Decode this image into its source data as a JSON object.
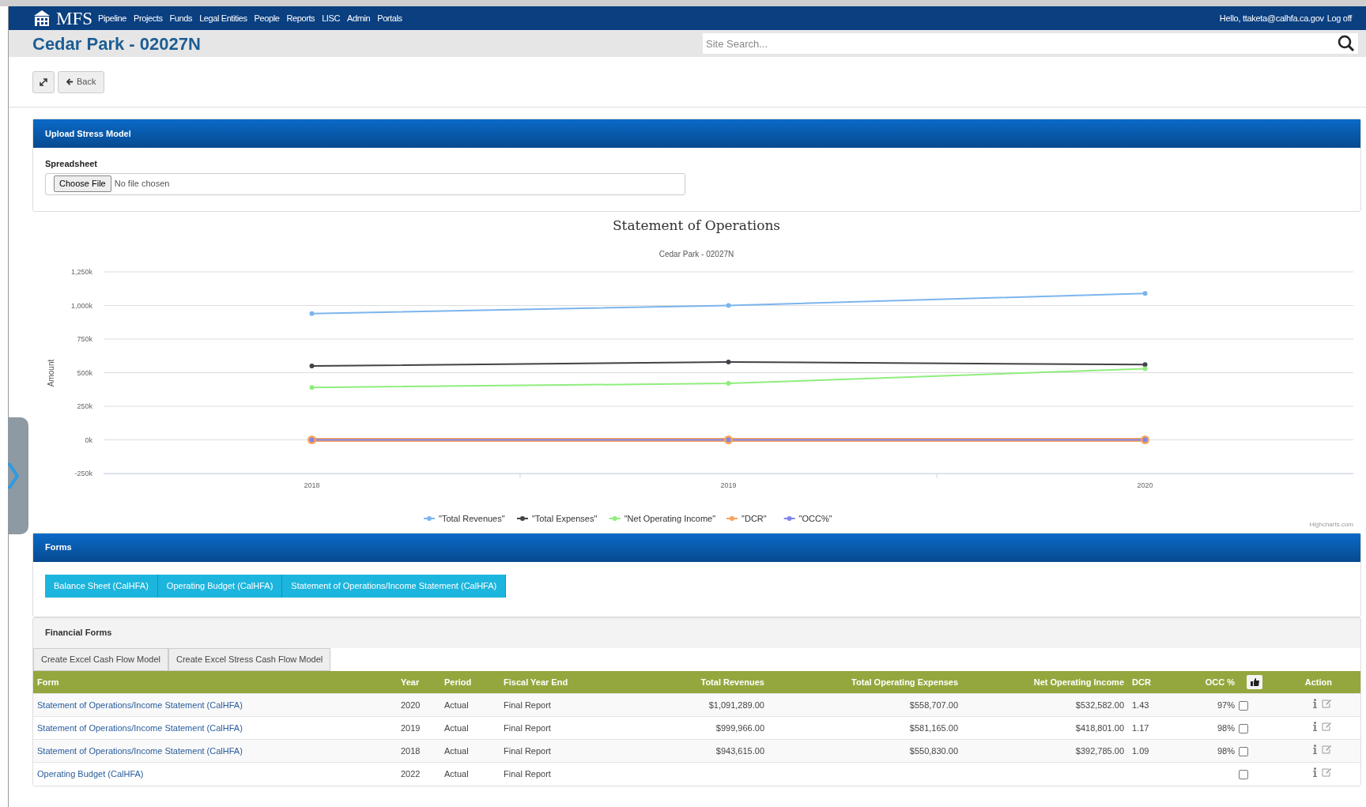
{
  "navbar": {
    "brand": "MFS",
    "items": [
      "Pipeline",
      "Projects",
      "Funds",
      "Legal Entities",
      "People",
      "Reports",
      "LISC",
      "Admin",
      "Portals"
    ],
    "greeting": "Hello, ttaketa@calhfa.ca.gov",
    "logoff": "Log off"
  },
  "title_bar": {
    "title": "Cedar Park - 02027N",
    "search": {
      "placeholder": "Site Search..."
    }
  },
  "toolbar": {
    "back": "Back"
  },
  "upload_panel": {
    "title": "Upload Stress Model",
    "field_label": "Spreadsheet",
    "choose_button": "Choose File",
    "file_status": "No file chosen"
  },
  "chart": {
    "subtitle": "Cedar Park - 02027N",
    "credit": "Highcharts.com",
    "chart_data": {
      "type": "line",
      "grid": true,
      "legend": true,
      "title": "Statement of Operations",
      "ylabel": "Amount",
      "categories": [
        "2018",
        "2019",
        "2020"
      ],
      "ylim": [
        -250000,
        1250000
      ],
      "yticks": [
        {
          "value": -250000,
          "label": "-250k"
        },
        {
          "value": 0,
          "label": "0k"
        },
        {
          "value": 250000,
          "label": "250k"
        },
        {
          "value": 500000,
          "label": "500k"
        },
        {
          "value": 750000,
          "label": "750k"
        },
        {
          "value": 1000000,
          "label": "1,000k"
        },
        {
          "value": 1250000,
          "label": "1,250k"
        }
      ],
      "series": [
        {
          "name": "\"Total Revenues\"",
          "color": "#7cb5ec",
          "marker": true,
          "values": [
            940000,
            1000000,
            1090000
          ]
        },
        {
          "name": "\"Total Expenses\"",
          "color": "#434348",
          "marker": true,
          "values": [
            550000,
            580000,
            560000
          ]
        },
        {
          "name": "\"Net Operating Income\"",
          "color": "#90ed7d",
          "marker": true,
          "values": [
            390000,
            420000,
            530000
          ]
        },
        {
          "name": "\"DCR\"",
          "color": "#f7a35c",
          "marker": true,
          "values": [
            0,
            0,
            0
          ]
        },
        {
          "name": "\"OCC%\"",
          "color": "#8085e9",
          "marker": true,
          "values": [
            0,
            0,
            0
          ]
        }
      ]
    }
  },
  "forms_panel": {
    "title": "Forms",
    "buttons": [
      "Balance Sheet (CalHFA)",
      "Operating Budget (CalHFA)",
      "Statement of Operations/Income Statement (CalHFA)"
    ]
  },
  "financial_forms": {
    "title": "Financial Forms",
    "buttons": [
      "Create Excel Cash Flow Model",
      "Create Excel Stress Cash Flow Model"
    ],
    "columns": [
      "Form",
      "Year",
      "Period",
      "Fiscal Year End",
      "Total Revenues",
      "Total Operating Expenses",
      "Net Operating Income",
      "DCR",
      "OCC %",
      "Action"
    ],
    "rows": [
      {
        "form": "Statement of Operations/Income Statement (CalHFA)",
        "year": "2020",
        "period": "Actual",
        "fiscal_year_end": "Final Report",
        "total_revenues": "$1,091,289.00",
        "total_operating_expenses": "$558,707.00",
        "net_operating_income": "$532,582.00",
        "dcr": "1.43",
        "occ": "97%",
        "checked": false
      },
      {
        "form": "Statement of Operations/Income Statement (CalHFA)",
        "year": "2019",
        "period": "Actual",
        "fiscal_year_end": "Final Report",
        "total_revenues": "$999,966.00",
        "total_operating_expenses": "$581,165.00",
        "net_operating_income": "$418,801.00",
        "dcr": "1.17",
        "occ": "98%",
        "checked": false
      },
      {
        "form": "Statement of Operations/Income Statement (CalHFA)",
        "year": "2018",
        "period": "Actual",
        "fiscal_year_end": "Final Report",
        "total_revenues": "$943,615.00",
        "total_operating_expenses": "$550,830.00",
        "net_operating_income": "$392,785.00",
        "dcr": "1.09",
        "occ": "98%",
        "checked": false
      },
      {
        "form": "Operating Budget (CalHFA)",
        "year": "2022",
        "period": "Actual",
        "fiscal_year_end": "Final Report",
        "checked": false
      }
    ]
  }
}
